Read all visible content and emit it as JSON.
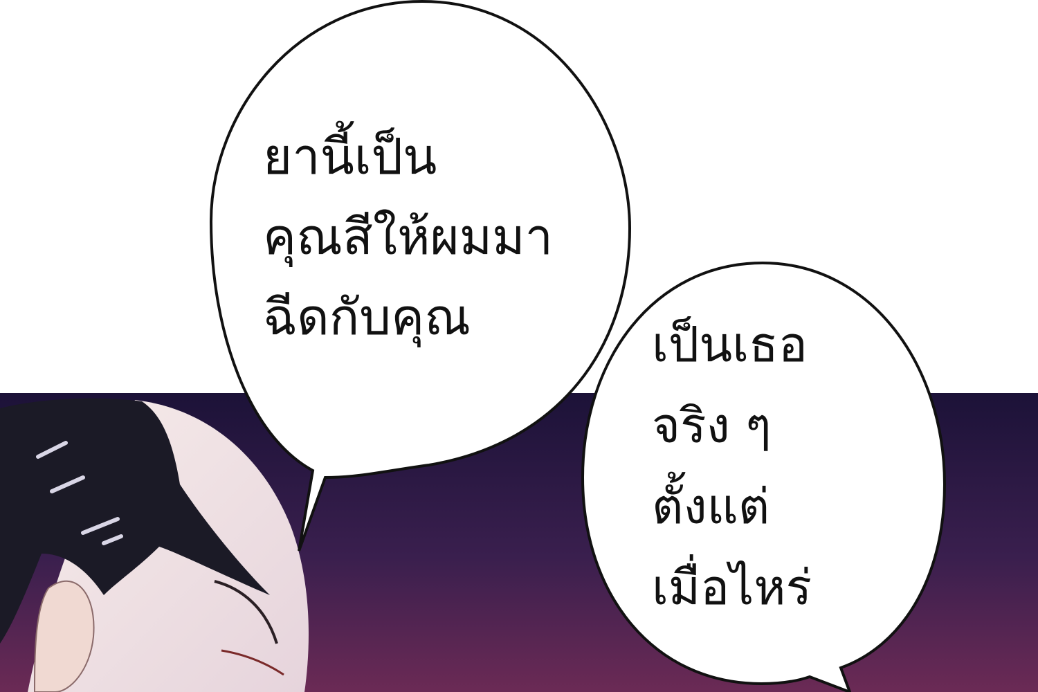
{
  "panel": {
    "speech_bubble_1": {
      "lines": [
        "ยานี้เป็น",
        "คุณสีให้ผมมา",
        "ฉีดกับคุณ"
      ]
    },
    "speech_bubble_2": {
      "lines": [
        "เป็นเธอ",
        "จริง ๆ",
        "ตั้งแต่",
        "เมื่อไหร่"
      ]
    },
    "colors": {
      "sky_top": "#1c1238",
      "sky_bottom": "#6b2a55",
      "bubble_fill": "#ffffff",
      "bubble_stroke": "#111111",
      "hair": "#1a1a24",
      "skin": "#f3e6e4"
    }
  }
}
